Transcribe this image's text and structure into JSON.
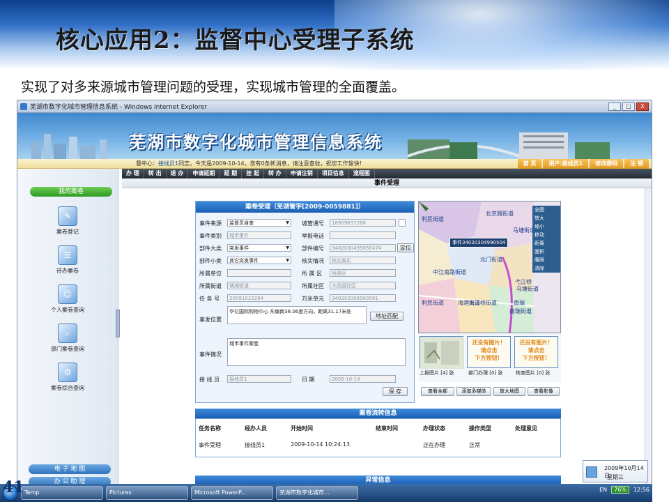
{
  "slide": {
    "title": "核心应用2：监督中心受理子系统",
    "subtitle": "实现了对多来源城市管理问题的受理，实现城市管理的全面覆盖。",
    "page_number": "41"
  },
  "browser": {
    "window_title": "芜湖市数字化城市管理信息系统 - Windows Internet Explorer",
    "buttons": [
      "_",
      "□",
      "X"
    ]
  },
  "app": {
    "banner_title": "芜湖市数字化城市管理信息系统",
    "info_prefix": "督中心：",
    "info_user": "接线员1",
    "info_text": "同志，今天是2009-10-14，您有0条新消息，请注意查收，祝您工作愉快！",
    "top_links": [
      "首 页",
      "用户:接线员1",
      "修改密码",
      "注 销"
    ],
    "my_cases": "我的案卷",
    "nav_items": [
      "案卷登记",
      "待办案卷",
      "个人案卷查询",
      "部门案卷查询",
      "案卷综合查询"
    ],
    "bottom_nav": [
      "电 子 地 图",
      "办 公 助 理"
    ],
    "tabs": [
      "办 理",
      "转 出",
      "退 办",
      "申请延期",
      "延 期",
      "挂 起",
      "转 办",
      "申请注销",
      "项目信息",
      "流程图"
    ],
    "page_heading": "事件受理"
  },
  "form": {
    "header": "案卷受理（芜湖管字[2009-0059881]）",
    "fields": {
      "source_label": "事件来源",
      "source_value": "监督员自查",
      "supervisor_no_label": "城管通号",
      "supervisor_no_value": "18909637266",
      "category_label": "事件类别",
      "category_value": "城市事件",
      "phone_label": "举报电话",
      "phone_value": "",
      "major_label": "部件大类",
      "major_value": "突发事件",
      "part_no_label": "部件编号",
      "part_no_value": "3402030499050474",
      "locate_button": "定位",
      "minor_label": "部件小类",
      "minor_value": "其它突发事件",
      "verify_label": "核实情况",
      "verify_value": "核实属实",
      "unit_label": "所属单位",
      "unit_value": "",
      "district_label": "所 属 区",
      "district_value": "镜湖区",
      "street_label": "所属街道",
      "street_value": "镜湖街道",
      "community_label": "所属社区",
      "community_value": "大花园社区",
      "task_label": "任 务 号",
      "task_value": "20091015284",
      "grid_label": "万米单元",
      "grid_value": "340202008000501",
      "location_label": "事发位置",
      "location_value": "华亿国际购物中心 东偏南38.06度方向，距离31.17米处",
      "address_button": "地址匹配",
      "desc_label": "事件情况",
      "desc_value": "城市事件案卷",
      "operator_label": "接 线 员",
      "operator_value": "接线员1",
      "date_label": "日 期",
      "date_value": "2009-10-14",
      "save_button": "保 存"
    }
  },
  "map": {
    "labels": [
      "北京路街道",
      "马塘街道",
      "北门街道",
      "中江南路街道",
      "利民街道",
      "大江桥街道",
      "利民街道",
      "南瑞",
      "南瑞街道",
      "弋江桥",
      "马塘街道",
      "海港街道"
    ],
    "tooltip": "事件34020304990504",
    "tools": [
      "全图",
      "放大",
      "缩小",
      "移动",
      "距离",
      "面积",
      "鹰眼",
      "清除"
    ]
  },
  "photos": {
    "no_image_line1": "还没有图片！",
    "no_image_line2": "请点击",
    "no_image_line3": "下方按钮！",
    "labels": [
      "上报图片 [4] 张",
      "部门办理 [0] 张",
      "核查图片 [0] 张"
    ],
    "buttons": [
      "查看全部",
      "添加多媒体",
      "放大地图",
      "查看影像"
    ]
  },
  "flow": {
    "header": "案卷流转信息",
    "columns": [
      "任务名称",
      "经办人员",
      "开始时间",
      "结束时间",
      "办理状态",
      "操作类型",
      "处理意见"
    ],
    "rows": [
      [
        "事件受理",
        "接线员1",
        "2009-10-14 10:24:13",
        "",
        "正在办理",
        "正常",
        ""
      ]
    ]
  },
  "error_header": "异常信息",
  "taskbar": {
    "items": [
      "Temp",
      "Pictures",
      "Microsoft PowerP...",
      "芜湖市数字化城市..."
    ],
    "lang": "EN",
    "battery": "76%",
    "time": "12:56"
  },
  "date_popup": {
    "date": "2009年10月14日",
    "weekday": "星期三"
  },
  "colors": {
    "accent_blue": "#1b5fb4",
    "nav_green": "#2d9a24",
    "header_blue": "#2f6fc6"
  }
}
